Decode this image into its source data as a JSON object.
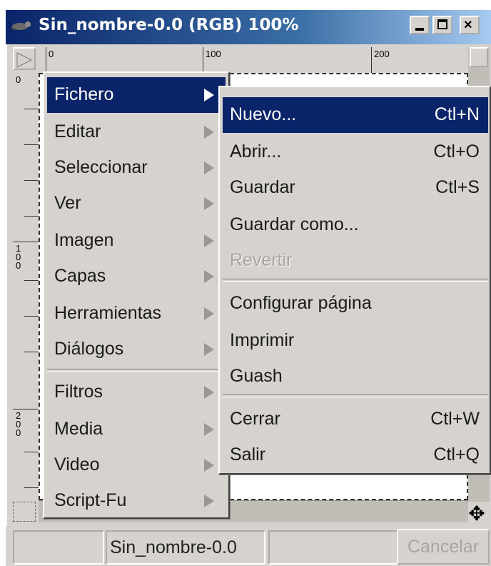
{
  "window": {
    "title": "Sin_nombre-0.0 (RGB) 100%",
    "buttons": [
      "minimize",
      "maximize",
      "close"
    ]
  },
  "rulers": {
    "horizontal_labels": [
      "0",
      "100",
      "200"
    ],
    "vertical_labels": [
      "0",
      "100",
      "200"
    ]
  },
  "main_menu": {
    "items": [
      {
        "label": "Fichero",
        "submenu": true,
        "highlighted": true
      },
      {
        "label": "Editar",
        "submenu": true
      },
      {
        "label": "Seleccionar",
        "submenu": true
      },
      {
        "label": "Ver",
        "submenu": true
      },
      {
        "label": "Imagen",
        "submenu": true
      },
      {
        "label": "Capas",
        "submenu": true
      },
      {
        "label": "Herramientas",
        "submenu": true
      },
      {
        "label": "Diálogos",
        "submenu": true
      },
      {
        "label": "Filtros",
        "submenu": true
      },
      {
        "label": "Media",
        "submenu": true
      },
      {
        "label": "Video",
        "submenu": true
      },
      {
        "label": "Script-Fu",
        "submenu": true
      }
    ]
  },
  "file_menu": {
    "items": [
      {
        "label": "Nuevo...",
        "accel": "Ctl+N",
        "highlighted": true
      },
      {
        "label": "Abrir...",
        "accel": "Ctl+O"
      },
      {
        "label": "Guardar",
        "accel": "Ctl+S"
      },
      {
        "label": "Guardar como...",
        "accel": ""
      },
      {
        "label": "Revertir",
        "accel": "",
        "disabled": true
      },
      {
        "label": "Configurar página",
        "accel": ""
      },
      {
        "label": "Imprimir",
        "accel": ""
      },
      {
        "label": "Guash",
        "accel": ""
      },
      {
        "label": "Cerrar",
        "accel": "Ctl+W"
      },
      {
        "label": "Salir",
        "accel": "Ctl+Q"
      }
    ]
  },
  "statusbar": {
    "image_name": "Sin_nombre-0.0",
    "cancel_label": "Cancelar"
  },
  "colors": {
    "highlight": "#0a246a",
    "menu_bg": "#d6d3ce",
    "disabled_text": "#a8a6a0"
  }
}
